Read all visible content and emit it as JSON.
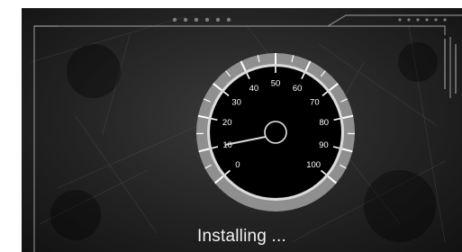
{
  "installer": {
    "status_text": "Installing ...",
    "progress_gauge": {
      "scale_min": 0,
      "scale_max": 100,
      "scale_labels": [
        "0",
        "10",
        "20",
        "30",
        "40",
        "50",
        "60",
        "70",
        "80",
        "90",
        "100"
      ],
      "needle_value": 10
    }
  },
  "colors": {
    "background": "#1e1e1e",
    "frame_line": "#9a9a9a",
    "gauge_ring": "#8f8f8f",
    "gauge_face": "#000000",
    "needle": "#d9d9d9",
    "text": "#f2f2f2"
  }
}
